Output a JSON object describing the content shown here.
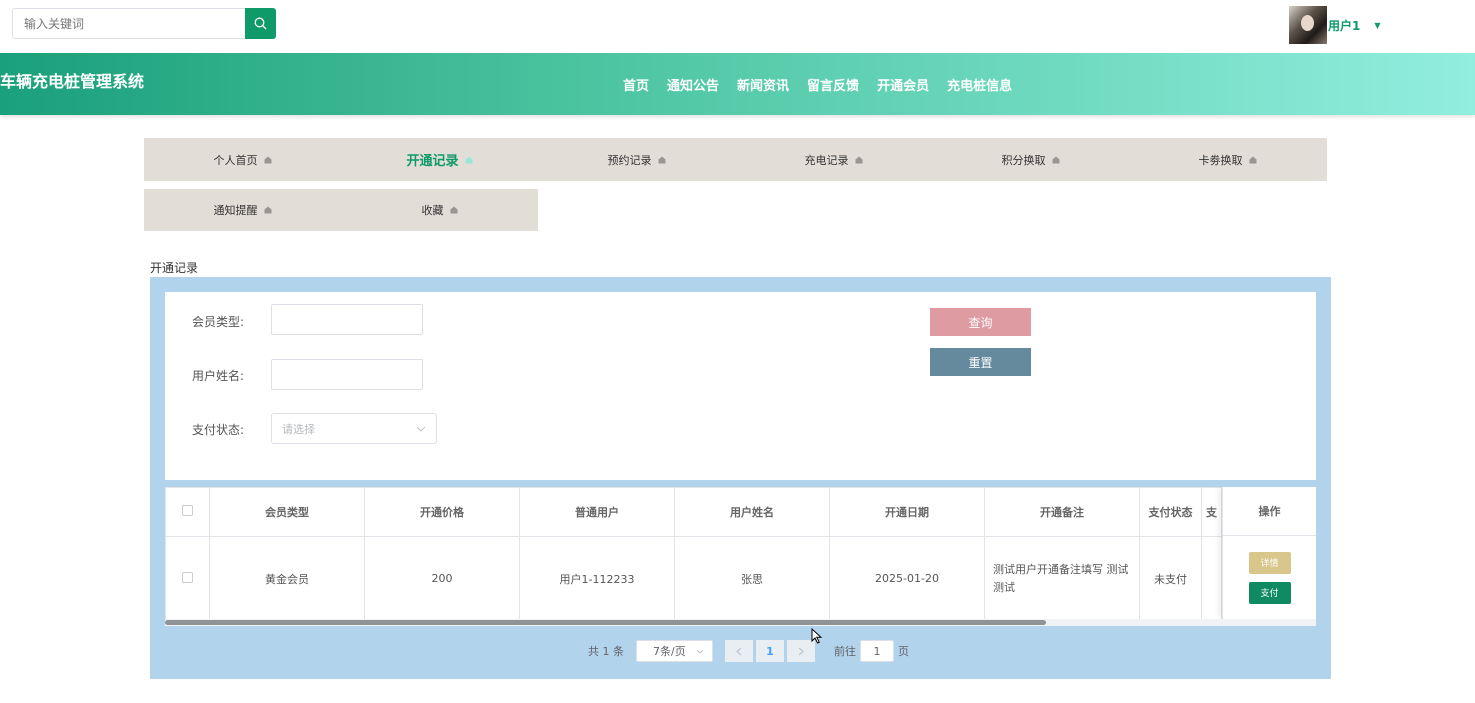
{
  "search": {
    "placeholder": "输入关键词"
  },
  "user": {
    "name": "用户1"
  },
  "header": {
    "site_title": "车辆充电桩管理系统",
    "nav": [
      "首页",
      "通知公告",
      "新闻资讯",
      "留言反馈",
      "开通会员",
      "充电桩信息"
    ]
  },
  "user_tabs": {
    "row1": [
      "个人首页",
      "开通记录",
      "预约记录",
      "充电记录",
      "积分换取",
      "卡劵换取"
    ],
    "row2": [
      "通知提醒",
      "收藏"
    ],
    "active": "开通记录"
  },
  "section_title": "开通记录",
  "filters": {
    "member_type_label": "会员类型:",
    "user_name_label": "用户姓名:",
    "pay_status_label": "支付状态:",
    "pay_status_placeholder": "请选择",
    "query_label": "查询",
    "reset_label": "重置"
  },
  "table": {
    "columns": [
      "会员类型",
      "开通价格",
      "普通用户",
      "用户姓名",
      "开通日期",
      "开通备注",
      "支付状态",
      "支",
      "操作"
    ],
    "rows": [
      {
        "member_type": "黄金会员",
        "price": "200",
        "normal_user": "用户1-112233",
        "user_name": "张思",
        "date": "2025-01-20",
        "note": "测试用户开通备注填写 测试测试",
        "pay_status": "未支付"
      }
    ],
    "detail_label": "详情",
    "pay_label": "支付"
  },
  "pagination": {
    "total": "共 1 条",
    "page_size": "7条/页",
    "current_page": "1",
    "goto_prefix": "前往",
    "goto_value": "1",
    "goto_suffix": "页"
  },
  "colors": {
    "accent": "#0f9a6a",
    "query_button": "#de9ba1",
    "reset_button": "#658a9e",
    "panel_blue": "#b2d3ec",
    "tab_bg": "#e3ddd7"
  }
}
